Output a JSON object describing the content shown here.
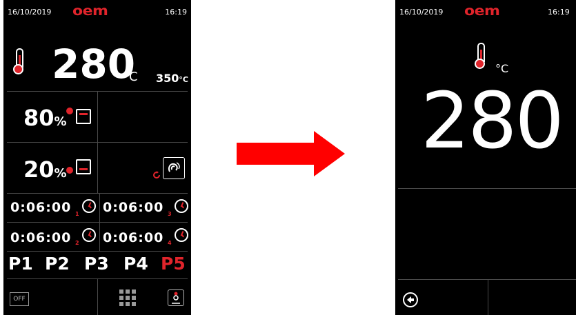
{
  "left_screen": {
    "date": "16/10/2019",
    "logo": "oem",
    "time": "16:19",
    "temperature": {
      "value": "280",
      "unit": "°C",
      "setpoint": "350",
      "setpoint_unit": "°C",
      "icon": "thermometer-icon"
    },
    "humidity_top": {
      "value": "80",
      "unit": "%",
      "icon": "top-element-icon"
    },
    "humidity_bottom": {
      "value": "20",
      "unit": "%",
      "icon": "bottom-element-icon"
    },
    "fan_icon": "fan-icon",
    "timers": [
      {
        "value": "0:06:00",
        "index": "1"
      },
      {
        "value": "0:06:00",
        "index": "3"
      },
      {
        "value": "0:06:00",
        "index": "2"
      },
      {
        "value": "0:06:00",
        "index": "4"
      }
    ],
    "programs": [
      {
        "label": "P1",
        "active": false
      },
      {
        "label": "P2",
        "active": false
      },
      {
        "label": "P3",
        "active": false
      },
      {
        "label": "P4",
        "active": false
      },
      {
        "label": "P5",
        "active": true
      }
    ],
    "off_label": "OFF",
    "menu_icon": "grid-icon",
    "user_icon": "user-icon"
  },
  "right_screen": {
    "date": "16/10/2019",
    "logo": "oem",
    "time": "16:19",
    "temperature": {
      "value": "280",
      "unit": "°C"
    },
    "back_icon": "back-arrow-icon"
  },
  "colors": {
    "accent": "#e0242b",
    "background": "#000000",
    "divider": "#4a4a4a"
  }
}
